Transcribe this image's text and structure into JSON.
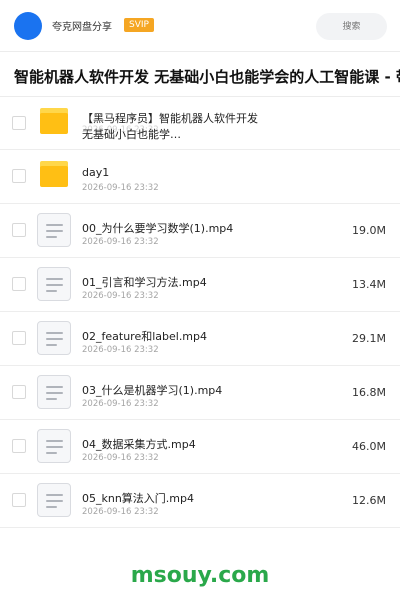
{
  "header": {
    "username": "夸克网盘分享",
    "badge": "SVIP",
    "search_placeholder": "搜索",
    "avatar_color": "#1a73f0"
  },
  "title": "智能机器人软件开发 无基础小白也能学会的人工智能课 - 带",
  "items": [
    {
      "type": "folder",
      "name": "【黑马程序员】智能机器人软件开发",
      "name2": "无基础小白也能学…",
      "date": "2026-09-16 23:32",
      "size": ""
    },
    {
      "type": "folder",
      "name": "day1",
      "date": "2026-09-16 23:32",
      "size": ""
    },
    {
      "type": "file",
      "name": "00_为什么要学习数学(1).mp4",
      "date": "2026-09-16 23:32",
      "size": "19.0M"
    },
    {
      "type": "file",
      "name": "01_引言和学习方法.mp4",
      "date": "2026-09-16 23:32",
      "size": "13.4M"
    },
    {
      "type": "file",
      "name": "02_feature和label.mp4",
      "date": "2026-09-16 23:32",
      "size": "29.1M"
    },
    {
      "type": "file",
      "name": "03_什么是机器学习(1).mp4",
      "date": "2026-09-16 23:32",
      "size": "16.8M"
    },
    {
      "type": "file",
      "name": "04_数据采集方式.mp4",
      "date": "2026-09-16 23:32",
      "size": "46.0M"
    },
    {
      "type": "file",
      "name": "05_knn算法入门.mp4",
      "date": "2026-09-16 23:32",
      "size": "12.6M"
    }
  ],
  "watermark": "msouy.com",
  "colors": {
    "badge": "#f5a623",
    "folder": "#ffbf14",
    "watermark": "#2aa84a"
  }
}
